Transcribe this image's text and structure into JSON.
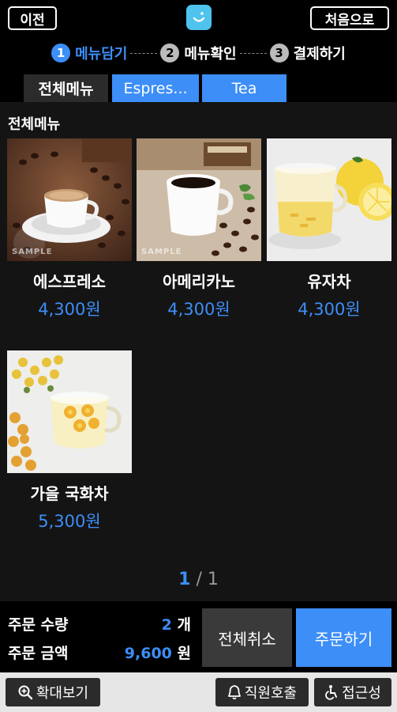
{
  "header": {
    "prev_label": "이전",
    "home_label": "처음으로"
  },
  "steps": [
    {
      "num": "1",
      "label": "메뉴담기",
      "active": true
    },
    {
      "num": "2",
      "label": "메뉴확인",
      "active": false
    },
    {
      "num": "3",
      "label": "결제하기",
      "active": false
    }
  ],
  "tabs": [
    {
      "label": "전체메뉴",
      "selected": true
    },
    {
      "label": "Espres...",
      "selected": false
    },
    {
      "label": "Tea",
      "selected": false
    }
  ],
  "section_title": "전체메뉴",
  "products": [
    {
      "name": "에스프레소",
      "price": "4,300원",
      "watermark": "SAMPLE"
    },
    {
      "name": "아메리카노",
      "price": "4,300원",
      "watermark": "SAMPLE"
    },
    {
      "name": "유자차",
      "price": "4,300원"
    },
    {
      "name": "가을 국화차",
      "price": "5,300원"
    }
  ],
  "pager": {
    "current": "1",
    "separator": "/",
    "total": "1"
  },
  "order": {
    "qty_label": "주문 수량",
    "qty_value": "2",
    "qty_unit": "개",
    "amount_label": "주문 금액",
    "amount_value": "9,600",
    "amount_unit": "원"
  },
  "actions": {
    "cancel_all": "전체취소",
    "order": "주문하기"
  },
  "bottom": {
    "zoom": "확대보기",
    "staff_call": "직원호출",
    "accessibility": "접근성"
  },
  "colors": {
    "accent": "#3d8ef7",
    "background": "#141414",
    "bar": "#000000"
  },
  "icons": {
    "logo": "smile-logo-icon",
    "zoom": "magnifier-plus-icon",
    "staff": "bell-icon",
    "accessibility": "wheelchair-icon"
  }
}
